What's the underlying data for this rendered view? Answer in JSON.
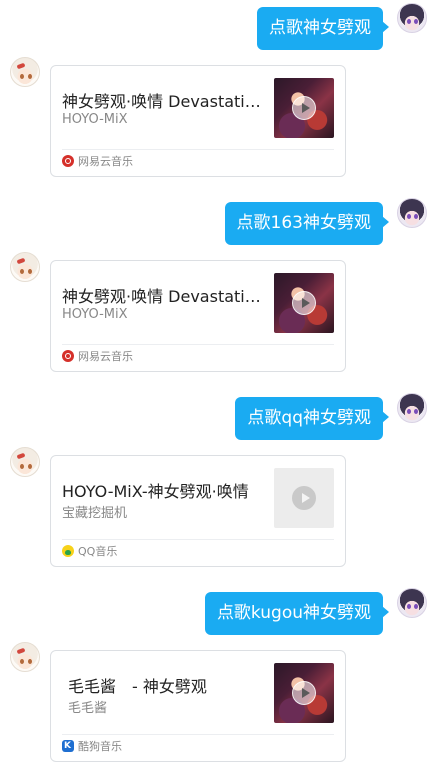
{
  "messages": [
    {
      "type": "user",
      "text": "点歌神女劈观"
    },
    {
      "type": "card",
      "title": "神女劈观·唤情 Devastating Beauty",
      "artist": "HOYO-MiX",
      "source": "网易云音乐",
      "source_icon": "netease-music-icon",
      "cover": "album-art"
    },
    {
      "type": "user",
      "text": "点歌163神女劈观"
    },
    {
      "type": "card",
      "title": "神女劈观·唤情 Devastating Beauty",
      "artist": "HOYO-MiX",
      "source": "网易云音乐",
      "source_icon": "netease-music-icon",
      "cover": "album-art"
    },
    {
      "type": "user",
      "text": "点歌qq神女劈观"
    },
    {
      "type": "card",
      "title": "HOYO-MiX-神女劈观·唤情",
      "artist": "宝藏挖掘机",
      "source": "QQ音乐",
      "source_icon": "qq-music-icon",
      "cover": "placeholder"
    },
    {
      "type": "user",
      "text": "点歌kugou神女劈观"
    },
    {
      "type": "card",
      "title": "毛毛酱　- 神女劈观",
      "artist": "毛毛酱",
      "source": "酷狗音乐",
      "source_icon": "kugou-music-icon",
      "cover": "album-art"
    }
  ],
  "colors": {
    "user_bubble": "#1aabf2",
    "card_border": "#dcdfe3",
    "netease": "#d5302a",
    "qq": "#f7d21a",
    "kugou": "#1f6fd1"
  }
}
